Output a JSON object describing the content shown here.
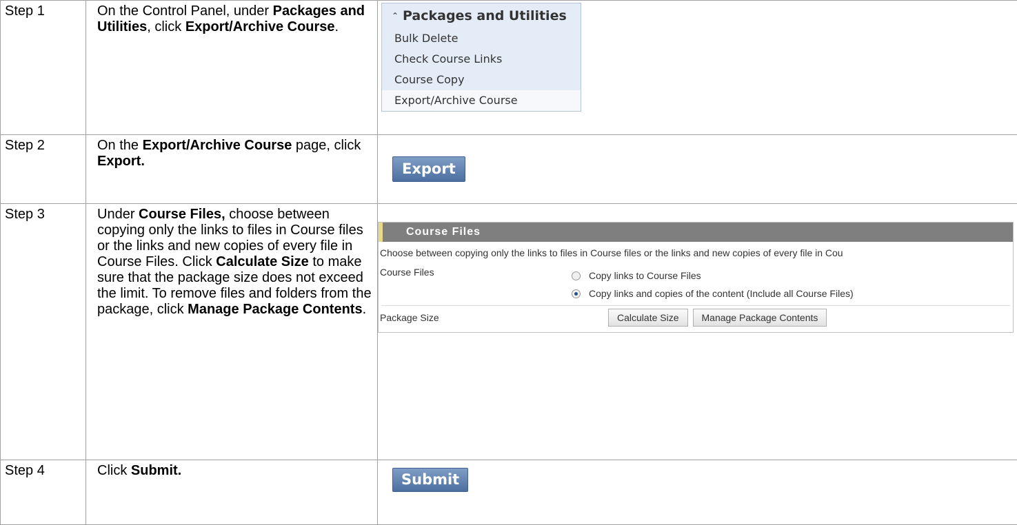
{
  "steps": [
    {
      "label": "Step 1",
      "instruction": {
        "p1": "On the Control Panel, under ",
        "b1": "Packages and Utilities",
        "p2": ", click ",
        "b2": "Export/Archive Course",
        "p3": "."
      },
      "menu": {
        "title": "Packages and Utilities",
        "chevron_icon": "double-chevron-up-icon",
        "items": [
          "Bulk Delete",
          "Check Course Links",
          "Course Copy",
          "Export/Archive Course"
        ]
      }
    },
    {
      "label": "Step 2",
      "instruction": {
        "p1": "On the ",
        "b1": "Export/Archive Course",
        "p2": " page, click ",
        "b2": "Export."
      },
      "button": "Export"
    },
    {
      "label": "Step 3",
      "instruction": {
        "p1": "Under ",
        "b1": "Course Files,",
        "p2": " choose between copying only the links to files in Course files or the links and new copies of every file in Course Files. Click ",
        "b2": "Calculate Size",
        "p3": " to make sure that the package size does not exceed the limit. To remove files and folders from the package, click ",
        "b3": "Manage Package Contents",
        "p4": "."
      },
      "panel": {
        "header": "Course Files",
        "description": "Choose between copying only the links to files in Course files or the links and new copies of every file in Cou",
        "course_files_label": "Course Files",
        "options": [
          {
            "label": "Copy links to Course Files",
            "selected": false
          },
          {
            "label": "Copy links and copies of the content (Include all Course Files)",
            "selected": true
          }
        ],
        "package_size_label": "Package Size",
        "calculate_button": "Calculate Size",
        "manage_button": "Manage Package Contents"
      }
    },
    {
      "label": "Step 4",
      "instruction": {
        "p1": "Click ",
        "b1": "Submit."
      },
      "button": "Submit"
    }
  ]
}
